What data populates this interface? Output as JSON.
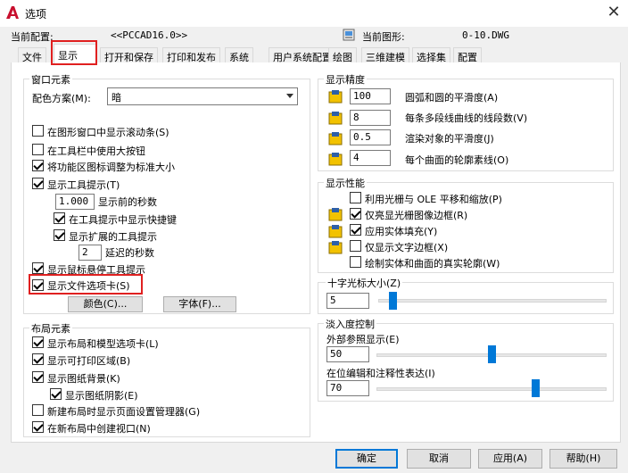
{
  "window": {
    "title": "选项",
    "close_glyph": "✕"
  },
  "header": {
    "current_profile_label": "当前配置:",
    "current_profile_value": "<<PCCAD16.0>>",
    "current_drawing_label": "当前图形:",
    "current_drawing_value": "0-10.DWG"
  },
  "tabs": [
    {
      "label": "文件"
    },
    {
      "label": "显示"
    },
    {
      "label": "打开和保存"
    },
    {
      "label": "打印和发布"
    },
    {
      "label": "系统"
    },
    {
      "label": "用户系统配置"
    },
    {
      "label": "绘图"
    },
    {
      "label": "三维建模"
    },
    {
      "label": "选择集"
    },
    {
      "label": "配置"
    }
  ],
  "window_elements": {
    "title": "窗口元素",
    "color_scheme_label": "配色方案(M):",
    "color_scheme_value": "暗",
    "checkboxes": [
      {
        "label": "在图形窗口中显示滚动条(S)",
        "checked": false
      },
      {
        "label": "在工具栏中使用大按钮",
        "checked": false
      },
      {
        "label": "将功能区图标调整为标准大小",
        "checked": true
      },
      {
        "label": "显示工具提示(T)",
        "checked": true
      }
    ],
    "tooltip_delay_value": "1.000",
    "tooltip_delay_label": "显示前的秒数",
    "show_shortcut_label": "在工具提示中显示快捷键",
    "show_extended_label": "显示扩展的工具提示",
    "extended_delay_value": "2",
    "extended_delay_label": "延迟的秒数",
    "rollover_label": "显示鼠标悬停工具提示",
    "file_tabs_label": "显示文件选项卡(S)",
    "colors_button": "颜色(C)...",
    "fonts_button": "字体(F)..."
  },
  "layout_elements": {
    "title": "布局元素",
    "items": [
      {
        "label": "显示布局和模型选项卡(L)",
        "checked": true
      },
      {
        "label": "显示可打印区域(B)",
        "checked": true
      },
      {
        "label": "显示图纸背景(K)",
        "checked": true
      },
      {
        "label": "显示图纸阴影(E)",
        "checked": true
      },
      {
        "label": "新建布局时显示页面设置管理器(G)",
        "checked": false
      },
      {
        "label": "在新布局中创建视口(N)",
        "checked": true
      }
    ]
  },
  "display_resolution": {
    "title": "显示精度",
    "items": [
      {
        "value": "100",
        "label": "圆弧和圆的平滑度(A)"
      },
      {
        "value": "8",
        "label": "每条多段线曲线的线段数(V)"
      },
      {
        "value": "0.5",
        "label": "渲染对象的平滑度(J)"
      },
      {
        "value": "4",
        "label": "每个曲面的轮廓素线(O)"
      }
    ]
  },
  "display_performance": {
    "title": "显示性能",
    "items": [
      {
        "label": "利用光栅与 OLE 平移和缩放(P)",
        "checked": false
      },
      {
        "label": "仅亮显光栅图像边框(R)",
        "checked": true
      },
      {
        "label": "应用实体填充(Y)",
        "checked": true
      },
      {
        "label": "仅显示文字边框(X)",
        "checked": false
      },
      {
        "label": "绘制实体和曲面的真实轮廓(W)",
        "checked": false
      }
    ]
  },
  "crosshair": {
    "title": "十字光标大小(Z)",
    "value": "5",
    "fraction": 0.05
  },
  "fade": {
    "title": "淡入度控制",
    "xref_label": "外部参照显示(E)",
    "xref_value": "50",
    "xref_fraction": 0.5,
    "inplace_label": "在位编辑和注释性表达(I)",
    "inplace_value": "70",
    "inplace_fraction": 0.7
  },
  "buttons": {
    "ok": "确定",
    "cancel": "取消",
    "apply": "应用(A)",
    "help": "帮助(H)"
  },
  "colors": {
    "accent": "#0078d7",
    "highlight": "#e02020"
  }
}
